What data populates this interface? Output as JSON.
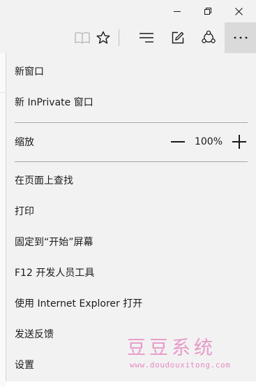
{
  "window": {
    "minimize_icon": "minimize-icon",
    "maximize_icon": "restore-icon",
    "close_icon": "close-icon"
  },
  "toolbar": {
    "icons": [
      "reading-view-icon",
      "favorite-star-icon",
      "hub-icon",
      "web-note-icon",
      "share-icon",
      "more-actions-icon"
    ]
  },
  "menu": {
    "new_window": "新窗口",
    "new_inprivate": "新 InPrivate 窗口",
    "zoom_label": "缩放",
    "zoom_value": "100%",
    "find_on_page": "在页面上查找",
    "print": "打印",
    "pin_to_start": "固定到“开始”屏幕",
    "dev_tools": "F12 开发人员工具",
    "open_with_ie": "使用 Internet Explorer 打开",
    "send_feedback": "发送反馈",
    "settings": "设置"
  },
  "watermark": {
    "title": "豆豆系统",
    "url": "www.doudouxitong.com"
  },
  "colors": {
    "background": "#f2f2f2",
    "active_button": "#dadada",
    "watermark": "#e79ac8"
  }
}
